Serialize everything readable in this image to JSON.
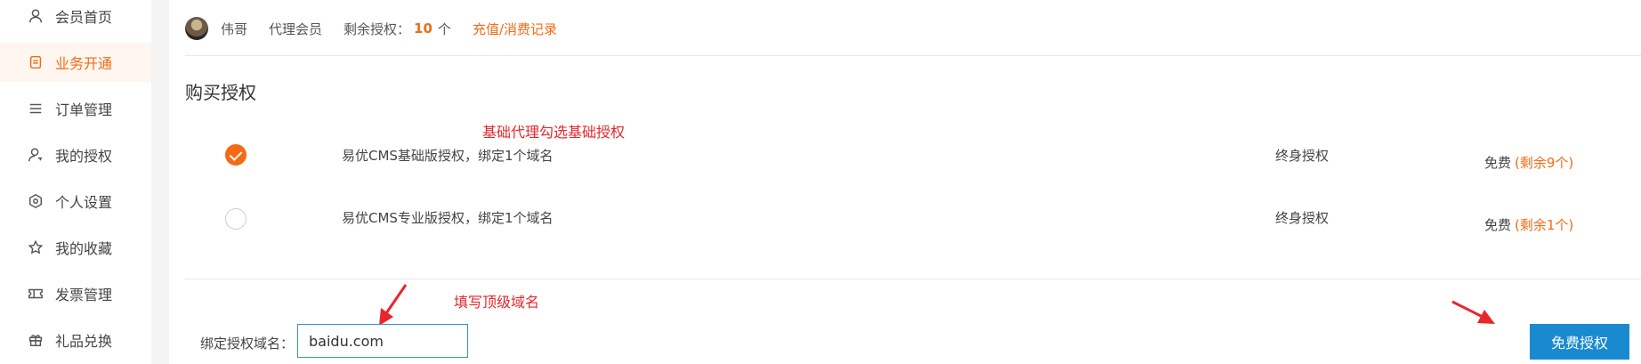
{
  "sidebar": {
    "items": [
      {
        "label": "会员首页",
        "icon": "user-icon",
        "active": false
      },
      {
        "label": "业务开通",
        "icon": "document-icon",
        "active": true
      },
      {
        "label": "订单管理",
        "icon": "list-icon",
        "active": false
      },
      {
        "label": "我的授权",
        "icon": "user-key-icon",
        "active": false
      },
      {
        "label": "个人设置",
        "icon": "settings-icon",
        "active": false
      },
      {
        "label": "我的收藏",
        "icon": "star-icon",
        "active": false
      },
      {
        "label": "发票管理",
        "icon": "ticket-icon",
        "active": false
      },
      {
        "label": "礼品兑换",
        "icon": "gift-icon",
        "active": false
      }
    ]
  },
  "user": {
    "name": "伟哥",
    "level": "代理会员",
    "remaining_label": "剩余授权：",
    "remaining_count": "10",
    "remaining_unit": "个",
    "records_link": "充值/消费记录"
  },
  "section": {
    "title": "购买授权"
  },
  "annotations": {
    "basic_note": "基础代理勾选基础授权",
    "domain_note": "填写顶级域名"
  },
  "licenses": [
    {
      "name": "易优CMS基础版授权，绑定1个域名",
      "term": "终身授权",
      "price": "免费",
      "remaining": "(剩余9个)",
      "selected": true
    },
    {
      "name": "易优CMS专业版授权，绑定1个域名",
      "term": "终身授权",
      "price": "免费",
      "remaining": "(剩余1个)",
      "selected": false
    }
  ],
  "domain_form": {
    "label": "绑定授权域名：",
    "value": "baidu.com"
  },
  "submit_button": {
    "label": "免费授权"
  },
  "colors": {
    "accent": "#f46a17",
    "primary_button": "#1a8ad0",
    "annotation": "#e8262d"
  }
}
